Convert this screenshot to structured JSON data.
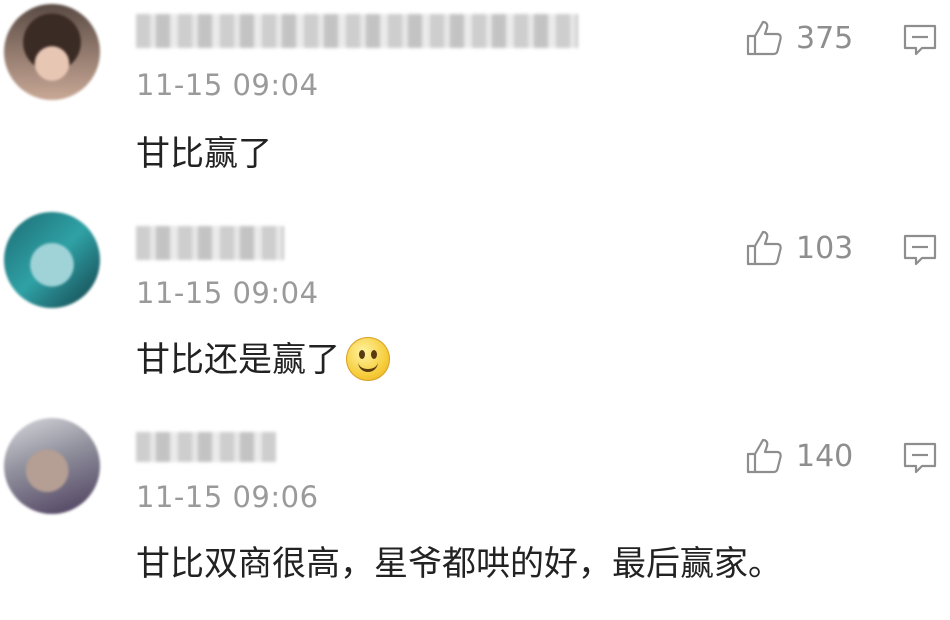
{
  "comments": [
    {
      "timestamp": "11-15 09:04",
      "text": "甘比赢了",
      "likes": "375",
      "has_emoji": false,
      "like_icon": "thumbs-up-icon",
      "reply_icon": "comment-icon"
    },
    {
      "timestamp": "11-15 09:04",
      "text": "甘比还是赢了",
      "likes": "103",
      "has_emoji": true,
      "emoji": "smile-emoji",
      "like_icon": "thumbs-up-icon",
      "reply_icon": "comment-icon"
    },
    {
      "timestamp": "11-15 09:06",
      "text": "甘比双商很高，星爷都哄的好，最后赢家。",
      "likes": "140",
      "has_emoji": false,
      "like_icon": "thumbs-up-icon",
      "reply_icon": "comment-icon"
    }
  ],
  "colors": {
    "text": "#222222",
    "muted": "#9a9a9a",
    "icon": "#8e8e8e",
    "background": "#ffffff"
  }
}
